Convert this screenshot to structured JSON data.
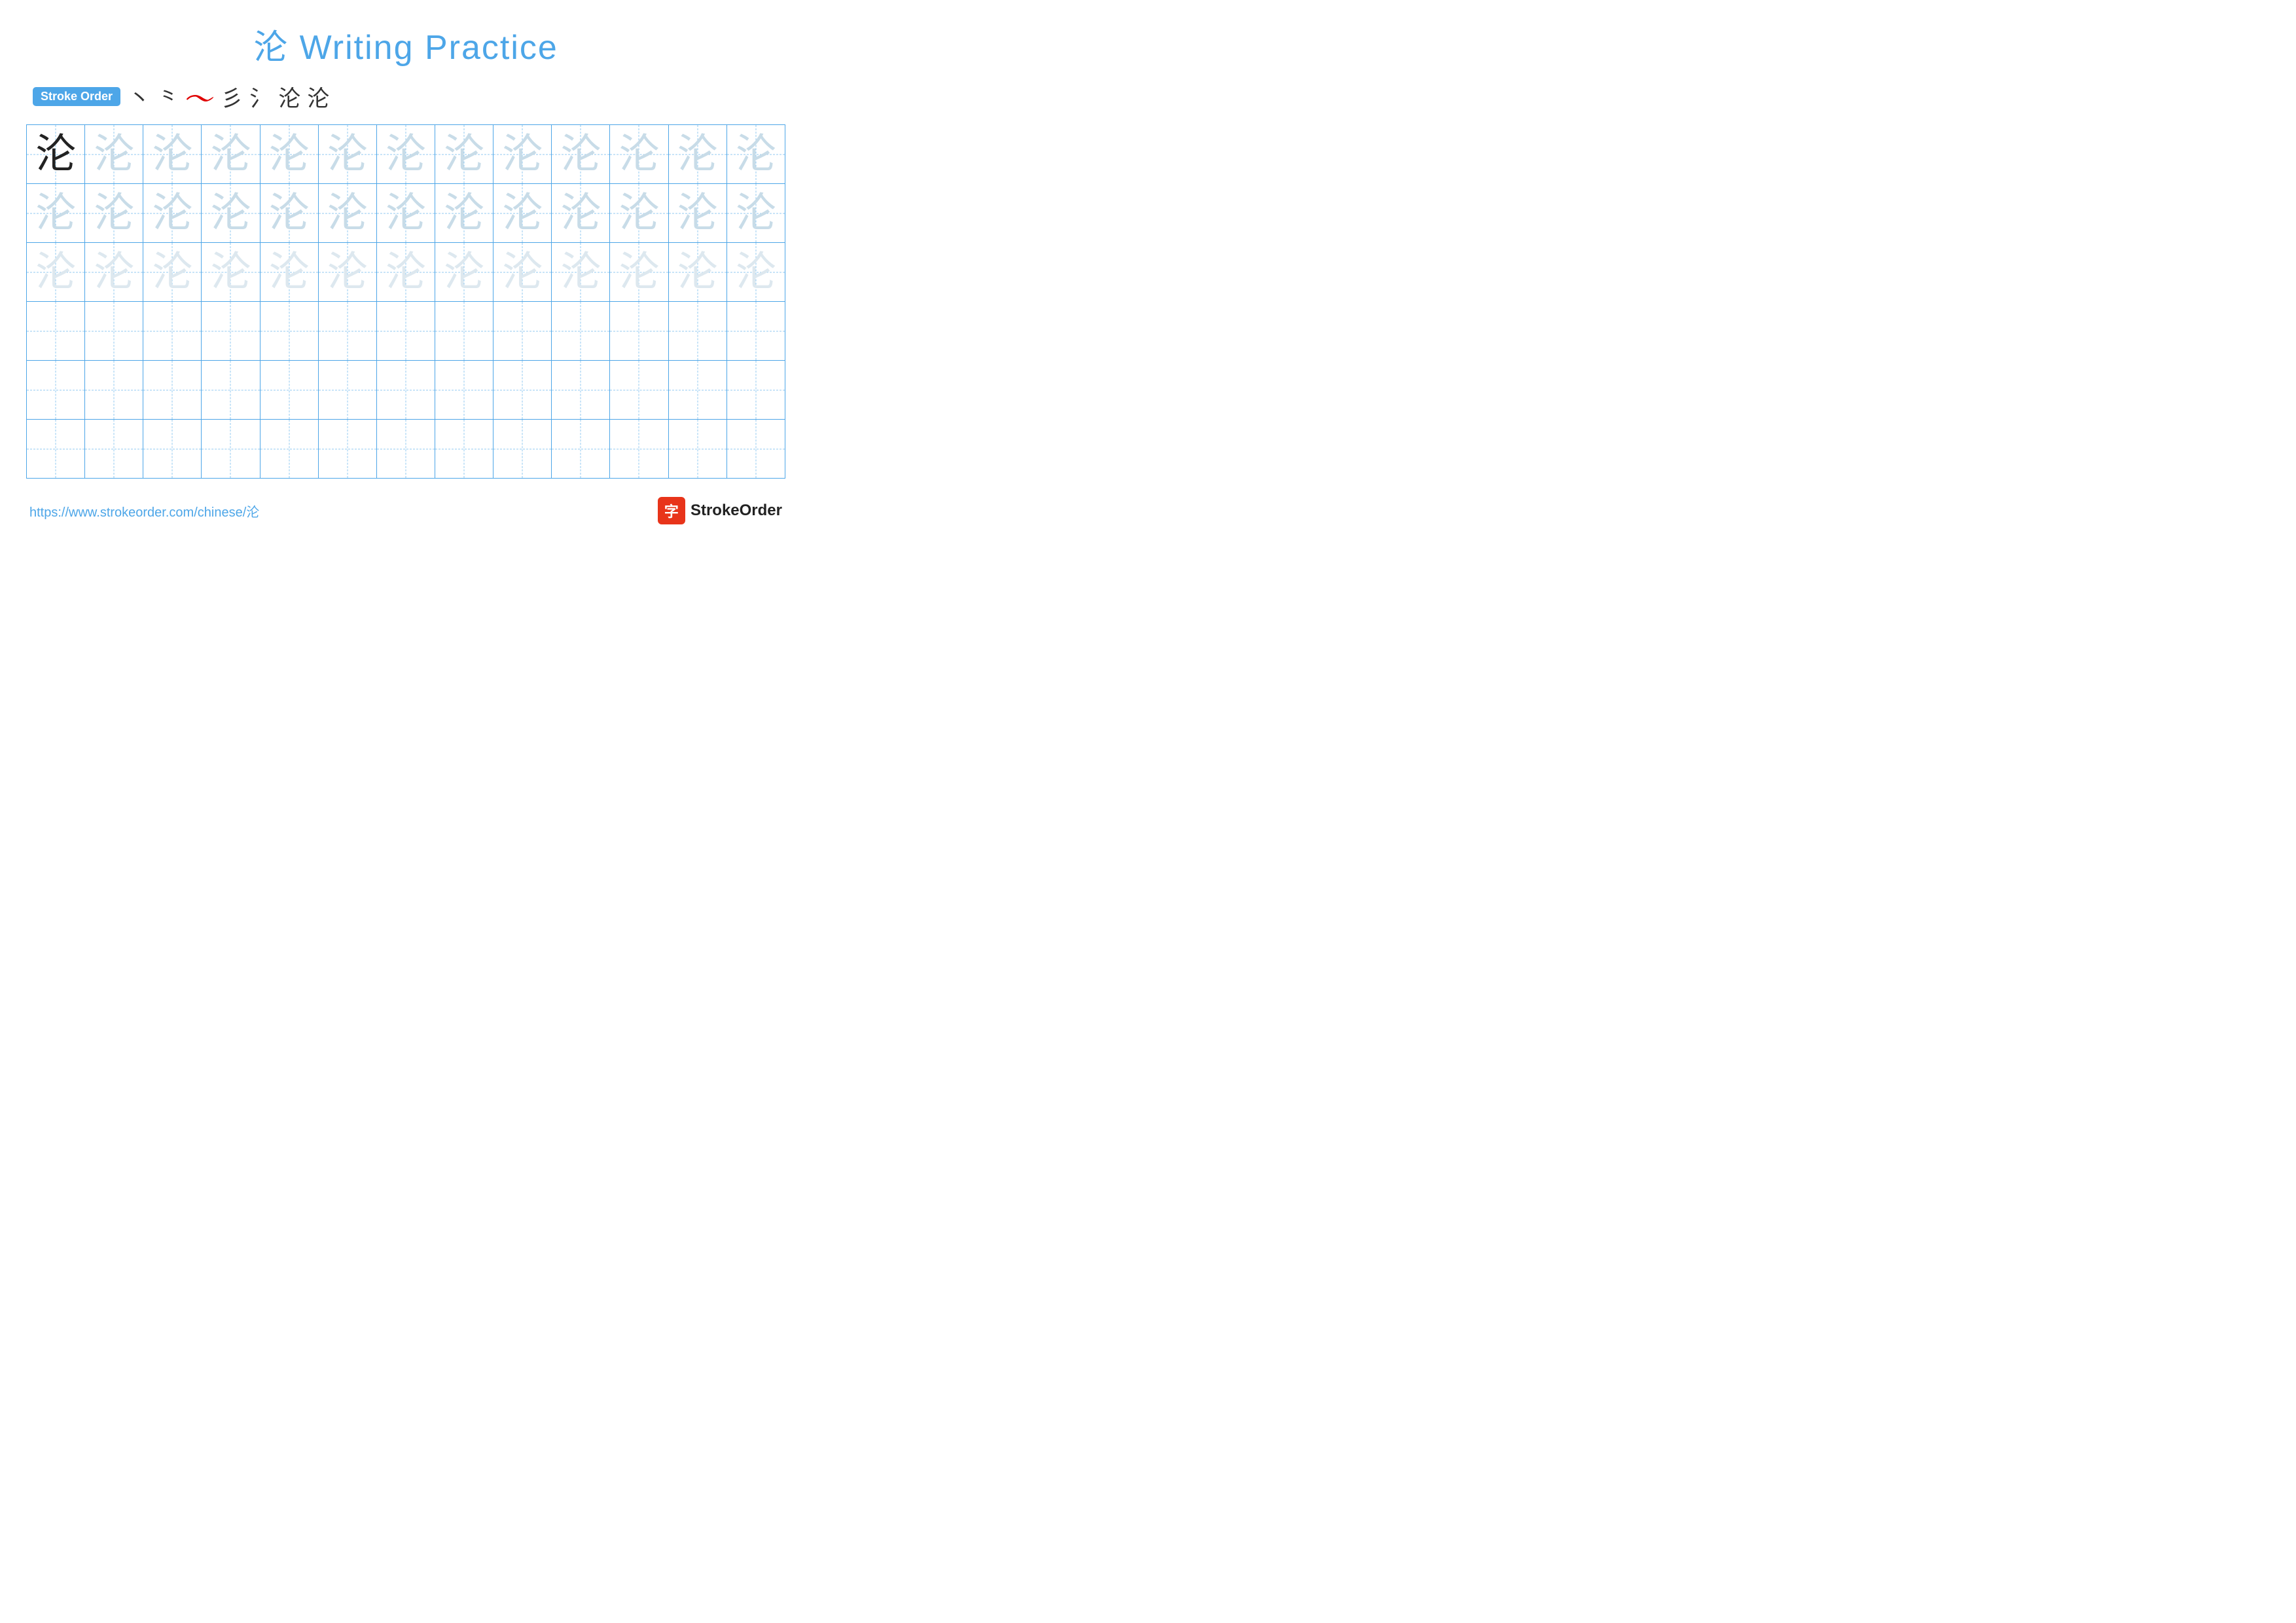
{
  "title": {
    "char": "沦",
    "text": " Writing Practice"
  },
  "stroke_order": {
    "badge_label": "Stroke Order",
    "strokes": [
      "丶",
      "丶",
      "𝀈",
      "彡",
      "氵",
      "沦",
      "沦"
    ]
  },
  "grid": {
    "rows": 6,
    "cols": 13,
    "chars": [
      [
        "dark",
        "light",
        "light",
        "light",
        "light",
        "light",
        "light",
        "light",
        "light",
        "light",
        "light",
        "light",
        "light"
      ],
      [
        "light",
        "light",
        "light",
        "light",
        "light",
        "light",
        "light",
        "light",
        "light",
        "light",
        "light",
        "light",
        "light"
      ],
      [
        "lighter",
        "lighter",
        "lighter",
        "lighter",
        "lighter",
        "lighter",
        "lighter",
        "lighter",
        "lighter",
        "lighter",
        "lighter",
        "lighter",
        "lighter"
      ],
      [
        "empty",
        "empty",
        "empty",
        "empty",
        "empty",
        "empty",
        "empty",
        "empty",
        "empty",
        "empty",
        "empty",
        "empty",
        "empty"
      ],
      [
        "empty",
        "empty",
        "empty",
        "empty",
        "empty",
        "empty",
        "empty",
        "empty",
        "empty",
        "empty",
        "empty",
        "empty",
        "empty"
      ],
      [
        "empty",
        "empty",
        "empty",
        "empty",
        "empty",
        "empty",
        "empty",
        "empty",
        "empty",
        "empty",
        "empty",
        "empty",
        "empty"
      ]
    ]
  },
  "footer": {
    "url": "https://www.strokeorder.com/chinese/沦",
    "logo_char": "字",
    "logo_text": "StrokeOrder"
  },
  "colors": {
    "blue": "#4da6e8",
    "red": "#e00000",
    "dark_char": "#222222",
    "light_char": "#c8dce8",
    "lighter_char": "#dde8ef"
  }
}
